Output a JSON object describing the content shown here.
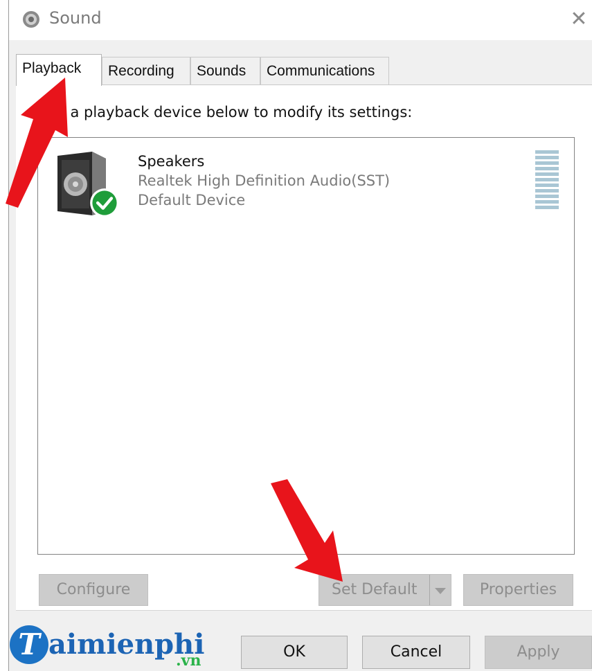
{
  "window": {
    "title": "Sound",
    "icons": {
      "app": "speaker-app-icon",
      "close": "close-icon"
    }
  },
  "tabs": [
    {
      "label": "Playback",
      "active": true
    },
    {
      "label": "Recording",
      "active": false
    },
    {
      "label": "Sounds",
      "active": false
    },
    {
      "label": "Communications",
      "active": false
    }
  ],
  "instruction": "ct a playback device below to modify its settings:",
  "devices": [
    {
      "name": "Speakers",
      "driver": "Realtek High Definition Audio(SST)",
      "status": "Default Device",
      "icon": "speaker-device-icon",
      "badge": "default-check-icon",
      "badge_color": "#1f9d3a"
    }
  ],
  "buttons": {
    "configure": "Configure",
    "set_default": "Set Default",
    "properties": "Properties",
    "ok": "OK",
    "cancel": "Cancel",
    "apply": "Apply"
  },
  "watermark": {
    "main": "aimienphi",
    "letter": "T",
    "suffix": ".vn"
  },
  "colors": {
    "annotation_arrow": "#e8141b",
    "logo_blue": "#1c64b4",
    "logo_green": "#2bb34a"
  }
}
